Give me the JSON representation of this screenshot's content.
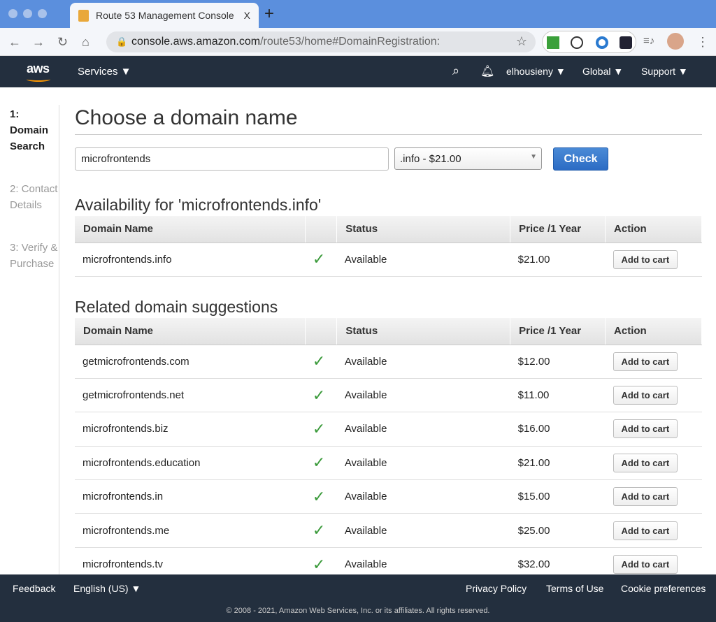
{
  "browser": {
    "tab_title": "Route 53 Management Console",
    "url_host": "console.aws.amazon.com",
    "url_path": "/route53/home#DomainRegistration:",
    "close": "X",
    "new_tab": "+"
  },
  "aws_nav": {
    "logo": "aws",
    "services": "Services ▼",
    "user": "elhousieny ▼",
    "region": "Global ▼",
    "support": "Support ▼"
  },
  "steps": [
    "1: Domain Search",
    "2: Contact Details",
    "3: Verify & Purchase"
  ],
  "page_title": "Choose a domain name",
  "search": {
    "value": "microfrontends",
    "tld": ".info - $21.00",
    "check": "Check"
  },
  "availability": {
    "title": "Availability for 'microfrontends.info'",
    "headers": [
      "Domain Name",
      "",
      "Status",
      "Price /1 Year",
      "Action"
    ],
    "rows": [
      {
        "domain": "microfrontends.info",
        "status": "Available",
        "price": "$21.00",
        "action": "Add to cart"
      }
    ]
  },
  "suggestions": {
    "title": "Related domain suggestions",
    "headers": [
      "Domain Name",
      "",
      "Status",
      "Price /1 Year",
      "Action"
    ],
    "rows": [
      {
        "domain": "getmicrofrontends.com",
        "status": "Available",
        "price": "$12.00",
        "action": "Add to cart"
      },
      {
        "domain": "getmicrofrontends.net",
        "status": "Available",
        "price": "$11.00",
        "action": "Add to cart"
      },
      {
        "domain": "microfrontends.biz",
        "status": "Available",
        "price": "$16.00",
        "action": "Add to cart"
      },
      {
        "domain": "microfrontends.education",
        "status": "Available",
        "price": "$21.00",
        "action": "Add to cart"
      },
      {
        "domain": "microfrontends.in",
        "status": "Available",
        "price": "$15.00",
        "action": "Add to cart"
      },
      {
        "domain": "microfrontends.me",
        "status": "Available",
        "price": "$25.00",
        "action": "Add to cart"
      },
      {
        "domain": "microfrontends.tv",
        "status": "Available",
        "price": "$32.00",
        "action": "Add to cart"
      }
    ]
  },
  "footer": {
    "feedback": "Feedback",
    "language": "English (US) ▼",
    "privacy": "Privacy Policy",
    "terms": "Terms of Use",
    "cookies": "Cookie preferences",
    "copyright": "© 2008 - 2021, Amazon Web Services, Inc. or its affiliates. All rights reserved."
  }
}
